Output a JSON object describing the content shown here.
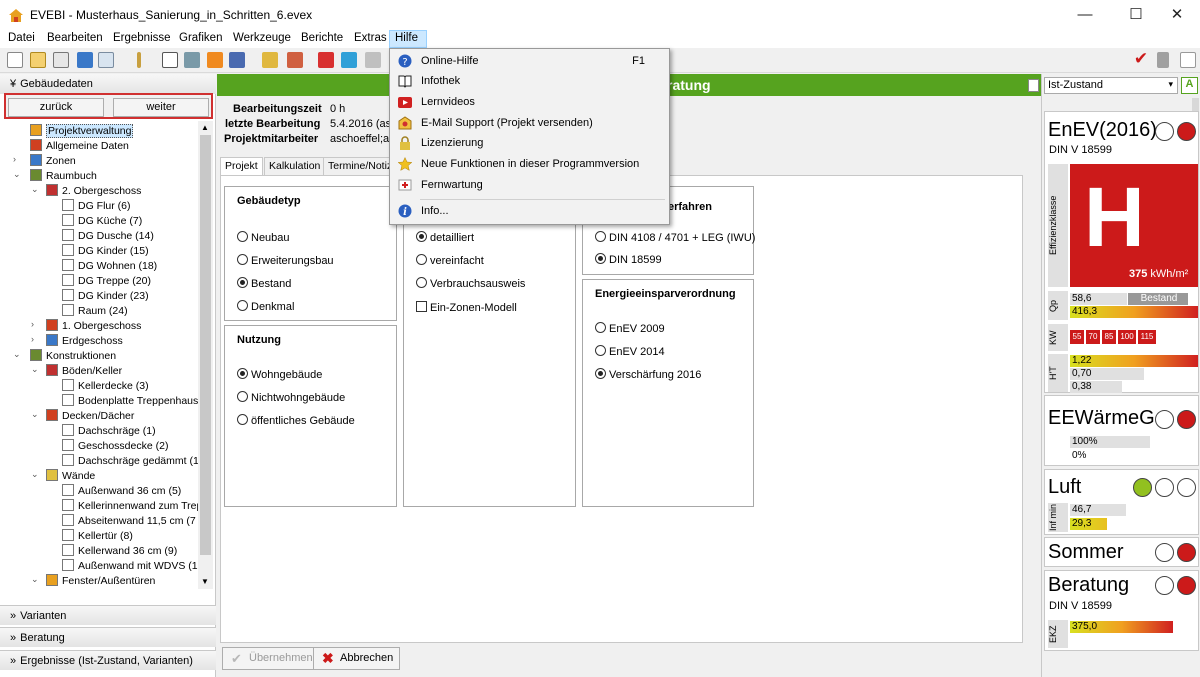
{
  "window": {
    "title": "EVEBI - Musterhaus_Sanierung_in_Schritten_6.evex",
    "minimize": "—",
    "maximize": "☐",
    "close": "✕"
  },
  "menubar": [
    "Datei",
    "Bearbeiten",
    "Ergebnisse",
    "Grafiken",
    "Werkzeuge",
    "Berichte",
    "Extras",
    "Hilfe"
  ],
  "help_menu": {
    "items": [
      {
        "label": "Online-Hilfe",
        "shortcut": "F1",
        "icon": "help-icon"
      },
      {
        "label": "Infothek",
        "icon": "book-icon"
      },
      {
        "label": "Lernvideos",
        "icon": "video-icon"
      },
      {
        "label": "E-Mail Support (Projekt versenden)",
        "icon": "email-icon"
      },
      {
        "label": "Lizenzierung",
        "icon": "lock-icon"
      },
      {
        "label": "Neue Funktionen in dieser Programmversion",
        "icon": "star-icon"
      },
      {
        "label": "Fernwartung",
        "icon": "remote-icon"
      },
      {
        "label": "Info...",
        "icon": "info-icon"
      }
    ]
  },
  "left_panel": {
    "header": "Gebäudedaten",
    "back": "zurück",
    "forward": "weiter",
    "tree": [
      {
        "label": "Projektverwaltung",
        "level": 1,
        "selected": true
      },
      {
        "label": "Allgemeine Daten",
        "level": 1
      },
      {
        "label": "Zonen",
        "level": 1,
        "expander": "›"
      },
      {
        "label": "Raumbuch",
        "level": 1,
        "expander": "⌄"
      },
      {
        "label": "2. Obergeschoss",
        "level": 2,
        "expander": "⌄"
      },
      {
        "label": "DG Flur (6)",
        "level": 3
      },
      {
        "label": "DG Küche (7)",
        "level": 3
      },
      {
        "label": "DG Dusche (14)",
        "level": 3
      },
      {
        "label": "DG Kinder (15)",
        "level": 3
      },
      {
        "label": "DG Wohnen (18)",
        "level": 3
      },
      {
        "label": "DG Treppe (20)",
        "level": 3
      },
      {
        "label": "DG Kinder (23)",
        "level": 3
      },
      {
        "label": "Raum (24)",
        "level": 3
      },
      {
        "label": "1. Obergeschoss",
        "level": 2,
        "expander": "›"
      },
      {
        "label": "Erdgeschoss",
        "level": 2,
        "expander": "›"
      },
      {
        "label": "Konstruktionen",
        "level": 1,
        "expander": "⌄"
      },
      {
        "label": "Böden/Keller",
        "level": 2,
        "expander": "⌄"
      },
      {
        "label": "Kellerdecke (3)",
        "level": 3
      },
      {
        "label": "Bodenplatte Treppenhaus",
        "level": 3
      },
      {
        "label": "Decken/Dächer",
        "level": 2,
        "expander": "⌄"
      },
      {
        "label": "Dachschräge (1)",
        "level": 3
      },
      {
        "label": "Geschossdecke (2)",
        "level": 3
      },
      {
        "label": "Dachschräge gedämmt (1",
        "level": 3
      },
      {
        "label": "Wände",
        "level": 2,
        "expander": "⌄"
      },
      {
        "label": "Außenwand 36 cm (5)",
        "level": 3
      },
      {
        "label": "Kellerinnenwand zum Trep",
        "level": 3
      },
      {
        "label": "Abseitenwand 11,5 cm (7",
        "level": 3
      },
      {
        "label": "Kellertür (8)",
        "level": 3
      },
      {
        "label": "Kellerwand 36 cm (9)",
        "level": 3
      },
      {
        "label": "Außenwand mit WDVS (1",
        "level": 3
      },
      {
        "label": "Fenster/Außentüren",
        "level": 2,
        "expander": "⌄"
      }
    ],
    "sections": [
      "Varianten",
      "Beratung",
      "Ergebnisse (Ist-Zustand, Varianten)"
    ]
  },
  "center": {
    "header": "ratung",
    "info": [
      {
        "label": "Bearbeitungszeit",
        "value": "0 h"
      },
      {
        "label": "letzte Bearbeitung",
        "value": "5.4.2016 (as"
      },
      {
        "label": "Projektmitarbeiter",
        "value": "aschoeffel;as"
      }
    ],
    "tabs": [
      "Projekt",
      "Kalkulation",
      "Termine/Notiz"
    ],
    "gebaeudetyp": {
      "title": "Gebäudetyp",
      "options": [
        "Neubau",
        "Erweiterungsbau",
        "Bestand",
        "Denkmal"
      ],
      "selected": "Bestand"
    },
    "nutzung": {
      "title": "Nutzung",
      "options": [
        "Wohngebäude",
        "Nichtwohngebäude",
        "öffentliches Gebäude"
      ],
      "selected": "Wohngebäude"
    },
    "verfahren": {
      "options": [
        "detailliert",
        "vereinfacht",
        "Verbrauchsausweis"
      ],
      "selected": "detailliert",
      "checkbox": "Ein-Zonen-Modell"
    },
    "rechenverfahren": {
      "title": "erfahren",
      "options": [
        "DIN 4108 / 4701 + LEG (IWU)",
        "DIN 18599"
      ],
      "selected": "DIN 18599"
    },
    "enev": {
      "title": "Energieeinsparverordnung",
      "options": [
        "EnEV 2009",
        "EnEV 2014",
        "Verschärfung 2016"
      ],
      "selected": "Verschärfung 2016"
    },
    "buttons": {
      "apply": "Übernehmen",
      "cancel": "Abbrechen"
    }
  },
  "right_panel": {
    "state_select": "Ist-Zustand",
    "enev": {
      "title": "EnEV(2016)",
      "subtitle": "DIN V 18599",
      "class_letter": "H",
      "class_label": "Effizienzklasse",
      "value": "375",
      "unit": "kWh/m²",
      "qp_label": "Qp",
      "qp_values": [
        "58,6",
        "416,3"
      ],
      "qp_status": "Bestand",
      "kw_label": "KW",
      "kw_values": [
        "55",
        "70",
        "85",
        "100",
        "115"
      ],
      "ht_label": "H'T",
      "ht_values": [
        "1,22",
        "0,70",
        "0,38"
      ]
    },
    "eew": {
      "title": "EEWärmeG",
      "values": [
        "100%",
        "0%"
      ]
    },
    "luft": {
      "title": "Luft",
      "label": "Inf min",
      "values": [
        "46,7",
        "29,3"
      ]
    },
    "sommer": {
      "title": "Sommer"
    },
    "beratung": {
      "title": "Beratung",
      "subtitle": "DIN V 18599",
      "label": "EKZ",
      "value": "375,0"
    },
    "colors": {
      "red": "#cc1a1a",
      "green": "#92c01f",
      "header_green": "#56a31f"
    }
  }
}
